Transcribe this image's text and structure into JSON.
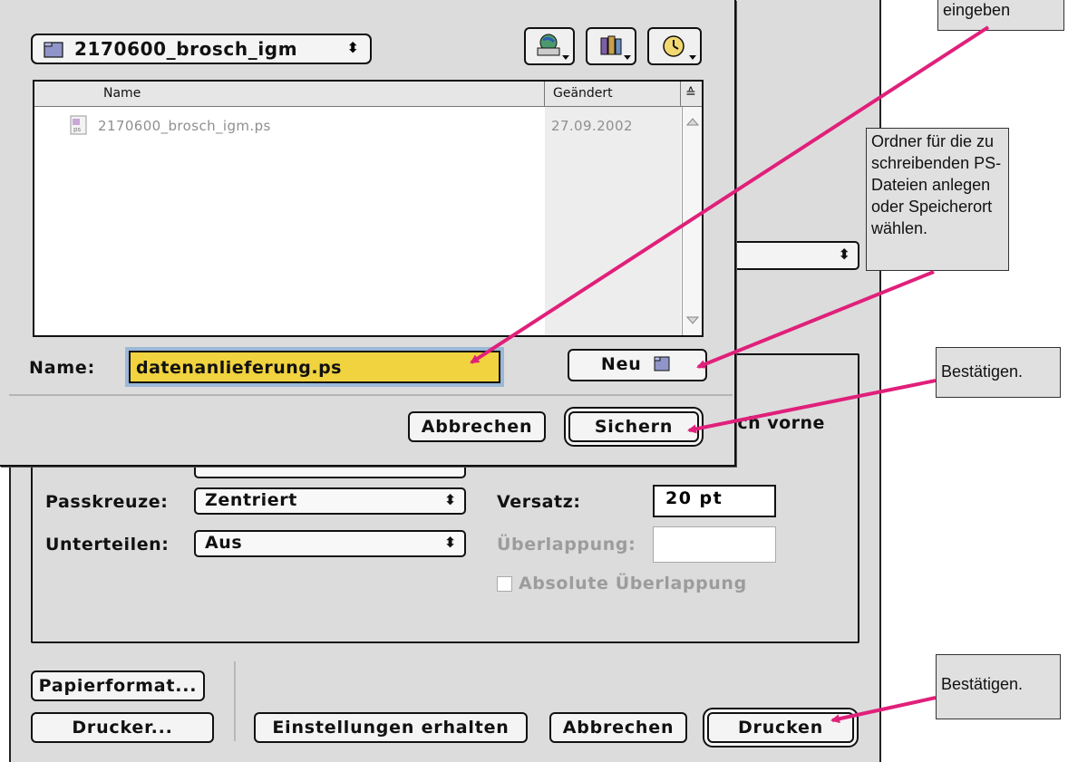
{
  "save_dialog": {
    "folder_popup": {
      "label": "2170600_brosch_igm",
      "icon": "folder-icon"
    },
    "nav_buttons": [
      {
        "icon": "desktop-disk-icon"
      },
      {
        "icon": "favorites-books-icon"
      },
      {
        "icon": "recent-clock-icon"
      }
    ],
    "file_list": {
      "columns": [
        "Name",
        "Geändert"
      ],
      "sort_indicator": "≙",
      "rows": [
        {
          "name": "2170600_brosch_igm.ps",
          "modified": "27.09.2002",
          "icon": "ps-document-icon"
        }
      ]
    },
    "name_label": "Name:",
    "name_value": "datenanlieferung.ps",
    "name_highlight_color": "#f0d33f",
    "new_folder_button": "Neu",
    "cancel_button": "Abbrechen",
    "save_button": "Sichern"
  },
  "print_dialog": {
    "partial_visible_text": "ach vorne",
    "fields": {
      "crop_marks_label": "Passkreuze:",
      "crop_marks_value": "Zentriert",
      "tile_label": "Unterteilen:",
      "tile_value": "Aus",
      "offset_label": "Versatz:",
      "offset_value": "20 pt",
      "overlap_label": "Überlappung:",
      "overlap_value": "",
      "absolute_overlap_label": "Absolute Überlappung"
    },
    "buttons": {
      "page_setup": "Papierformat...",
      "printer": "Drucker...",
      "save_settings": "Einstellungen erhalten",
      "cancel": "Abbrechen",
      "print": "Drucken"
    }
  },
  "callouts": {
    "name_callout": "eingeben",
    "folder_callout": "Ordner für die zu schreibenden PS-Dateien anlegen oder Speicherort wählen.",
    "save_confirm": "Bestätigen.",
    "print_confirm": "Bestätigen."
  },
  "colors": {
    "arrow": "#e0207a",
    "dialog_bg": "#dcdcdc",
    "selection_outline": "#9bb8d8"
  }
}
